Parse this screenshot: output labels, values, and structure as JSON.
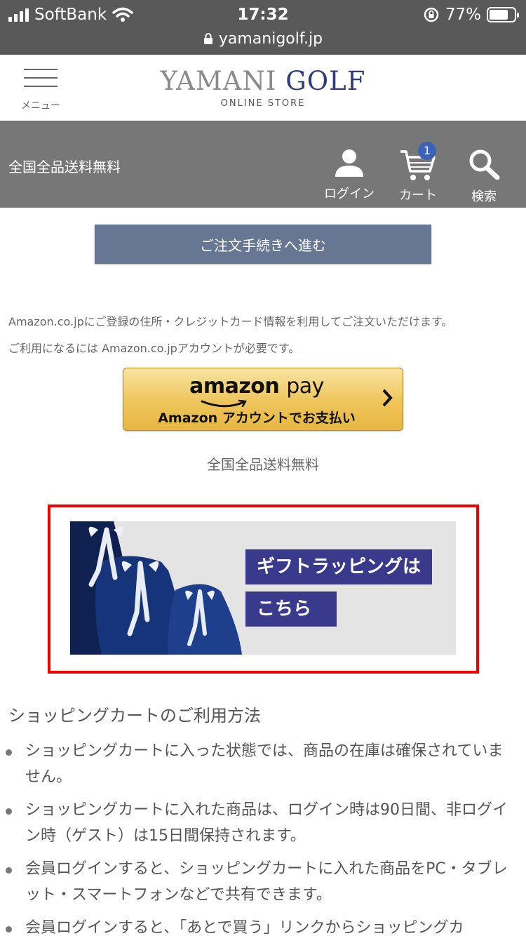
{
  "status_bar": {
    "carrier": "SoftBank",
    "time": "17:32",
    "battery_percent": "77%",
    "battery_level": 0.77,
    "url": "yamanigolf.jp"
  },
  "header": {
    "menu_label": "メニュー",
    "logo_word1": "YAMANI",
    "logo_word2": "GOLF",
    "logo_sub": "ONLINE STORE"
  },
  "toolbar": {
    "shipping": "全国全品送料無料",
    "login_label": "ログイン",
    "cart_label": "カート",
    "cart_count": "1",
    "search_label": "検索"
  },
  "main": {
    "checkout_button": "ご注文手続きへ進む",
    "amazon_info_line1": "Amazon.co.jpにご登録の住所・クレジットカード情報を利用してご注文いただけます。",
    "amazon_info_line2": "ご利用になるには Amazon.co.jpアカウントが必要です。",
    "amazon_logo_word": "amazon",
    "amazon_logo_pay": "pay",
    "amazon_button_sub": "Amazon アカウントでお支払い",
    "shipping_note": "全国全品送料無料",
    "gift_line1": "ギフトラッピングは",
    "gift_line2": "こちら"
  },
  "usage": {
    "title": "ショッピングカートのご利用方法",
    "items": [
      "ショッピングカートに入った状態では、商品の在庫は確保されていません。",
      "ショッピングカートに入れた商品は、ログイン時は90日間、非ログイン時（ゲスト）は15日間保持されます。",
      "会員ログインすると、ショッピングカートに入れた商品をPC・タブレット・スマートフォンなどで共有できます。",
      "会員ログインすると、「あとで買う」リンクからショッピングカ"
    ]
  },
  "colors": {
    "status_bar_bg": "#595959",
    "toolbar_bg": "#777777",
    "checkout_button_bg": "#667693",
    "logo_accent": "#2f3a7a",
    "gift_label_bg": "#3a3a8c",
    "highlight_frame": "#f00000",
    "cart_badge": "#3a63b7"
  }
}
